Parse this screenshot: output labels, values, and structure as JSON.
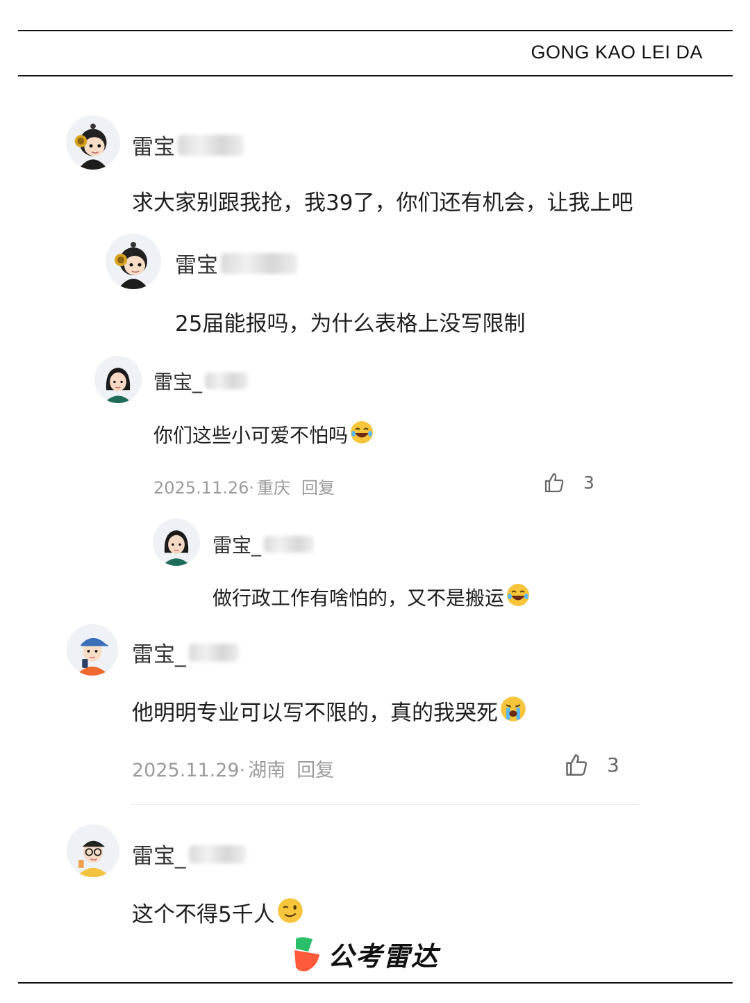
{
  "header": {
    "brand": "GONG KAO LEI DA"
  },
  "comments": [
    {
      "username": "雷宝",
      "text": "求大家别跟我抢，我39了，你们还有机会，让我上吧"
    },
    {
      "username": "雷宝",
      "text": "25届能报吗，为什么表格上没写限制"
    },
    {
      "username": "雷宝_",
      "text": "你们这些小可爱不怕吗",
      "date": "2025.11.26·",
      "location": "重庆",
      "reply": "回复",
      "likes": "3"
    },
    {
      "username": "雷宝_",
      "text": "做行政工作有啥怕的，又不是搬运"
    },
    {
      "username": "雷宝_",
      "text": "他明明专业可以写不限的，真的我哭死",
      "date": "2025.11.29·",
      "location": "湖南",
      "reply": "回复",
      "likes": "3"
    },
    {
      "username": "雷宝_",
      "text": "这个不得5千人"
    }
  ],
  "footer": {
    "logo_text": "公考雷达",
    "accent": "#2bbf6a",
    "accent2": "#ff5a3c"
  },
  "icons": [
    "thumbs-up-icon",
    "laughing-emoji-icon",
    "crying-emoji-icon",
    "winking-emoji-icon"
  ]
}
